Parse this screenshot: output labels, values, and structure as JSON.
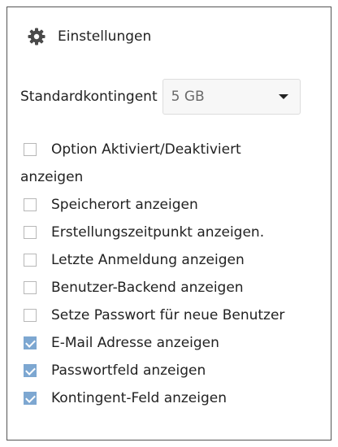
{
  "header": {
    "icon": "gear-icon",
    "title": "Einstellungen"
  },
  "quota": {
    "label": "Standardkontingent",
    "selected_value": "5 GB"
  },
  "options": [
    {
      "label_line1": "Option Aktiviert/Deaktiviert",
      "label_line2": "anzeigen",
      "checked": false
    },
    {
      "label": "Speicherort anzeigen",
      "checked": false
    },
    {
      "label": "Erstellungszeitpunkt anzeigen.",
      "checked": false
    },
    {
      "label": "Letzte Anmeldung anzeigen",
      "checked": false
    },
    {
      "label": "Benutzer-Backend anzeigen",
      "checked": false
    },
    {
      "label": "Setze Passwort für neue Benutzer",
      "checked": false
    },
    {
      "label": "E-Mail Adresse anzeigen",
      "checked": true
    },
    {
      "label": "Passwortfeld anzeigen",
      "checked": true
    },
    {
      "label": "Kontingent-Feld anzeigen",
      "checked": true
    }
  ],
  "colors": {
    "checkbox_checked": "#7da7d1",
    "border": "#555555"
  }
}
